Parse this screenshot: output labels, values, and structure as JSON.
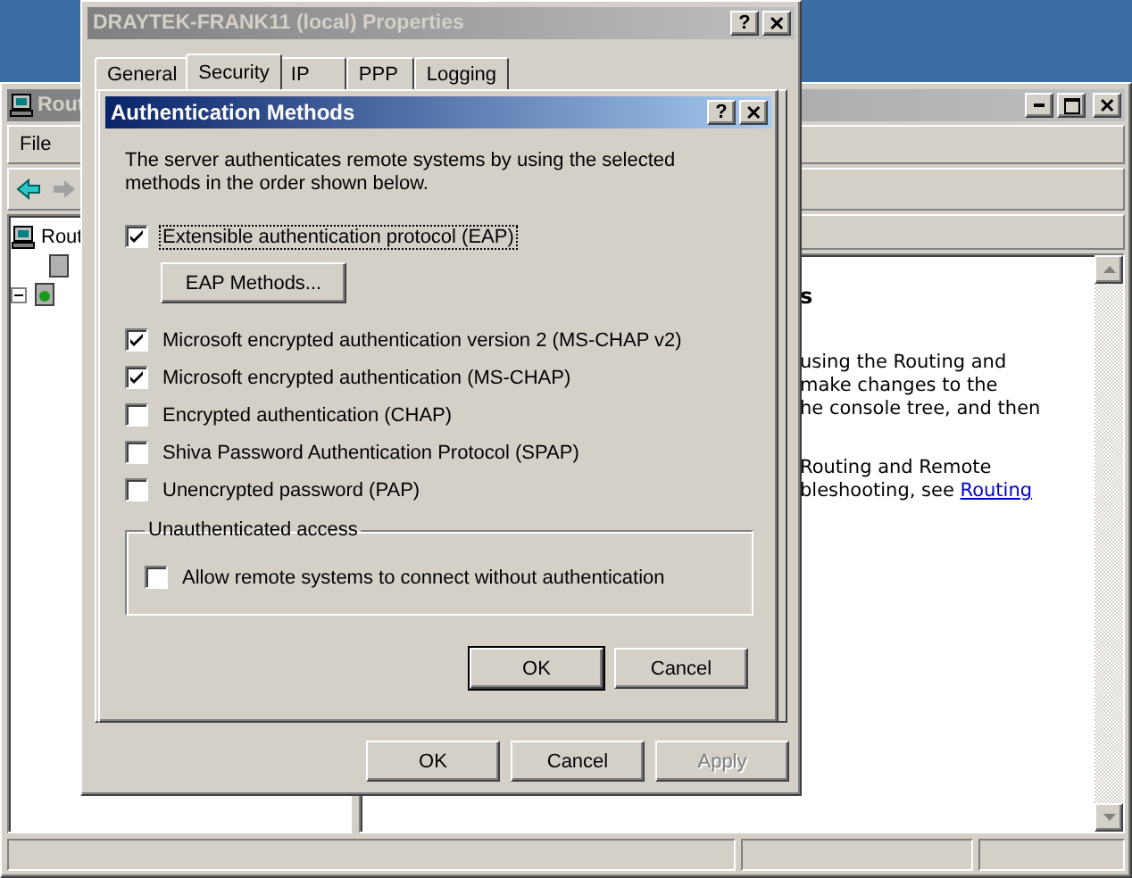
{
  "background_window": {
    "title": "Rout",
    "menu": [
      "File"
    ],
    "close_glyph": "✕",
    "tree": [
      {
        "label": "Rout",
        "kind": "computer",
        "children": [
          {
            "kind": "leaf"
          },
          {
            "kind": "node",
            "expanded": true
          }
        ]
      }
    ],
    "content": {
      "heading": "s",
      "paragraphs": [
        {
          "lines": [
            "using the Routing and",
            "make changes to the",
            "he console tree, and then"
          ]
        },
        {
          "lines": [
            "Routing and Remote",
            "bleshooting, see"
          ],
          "link": "Routing"
        }
      ]
    }
  },
  "properties_dialog": {
    "title": "DRAYTEK-FRANK11 (local) Properties",
    "help_glyph": "?",
    "close_glyph": "✕",
    "tabs": [
      {
        "label": "General",
        "selected": false
      },
      {
        "label": "Security",
        "selected": true
      },
      {
        "label": "IP",
        "selected": false
      },
      {
        "label": "PPP",
        "selected": false
      },
      {
        "label": "Logging",
        "selected": false
      }
    ],
    "buttons": [
      {
        "label": "OK",
        "disabled": false
      },
      {
        "label": "Cancel",
        "disabled": false
      },
      {
        "label": "Apply",
        "disabled": true
      }
    ]
  },
  "auth_dialog": {
    "title": "Authentication Methods",
    "help_glyph": "?",
    "close_glyph": "✕",
    "description": "The server authenticates remote systems by using the selected methods in the order shown below.",
    "methods": [
      {
        "label": "Extensible authentication protocol (EAP)",
        "checked": true,
        "focused": true,
        "button": "EAP Methods..."
      },
      {
        "label": "Microsoft encrypted authentication version 2 (MS-CHAP v2)",
        "checked": true,
        "focused": false
      },
      {
        "label": "Microsoft encrypted authentication (MS-CHAP)",
        "checked": true,
        "focused": false
      },
      {
        "label": "Encrypted authentication (CHAP)",
        "checked": false,
        "focused": false
      },
      {
        "label": "Shiva Password Authentication Protocol (SPAP)",
        "checked": false,
        "focused": false
      },
      {
        "label": "Unencrypted password (PAP)",
        "checked": false,
        "focused": false
      }
    ],
    "group": {
      "title": "Unauthenticated access",
      "option": {
        "label": "Allow remote systems to connect without authentication",
        "checked": false
      }
    },
    "buttons": [
      {
        "label": "OK",
        "default": true
      },
      {
        "label": "Cancel",
        "default": false
      }
    ]
  }
}
